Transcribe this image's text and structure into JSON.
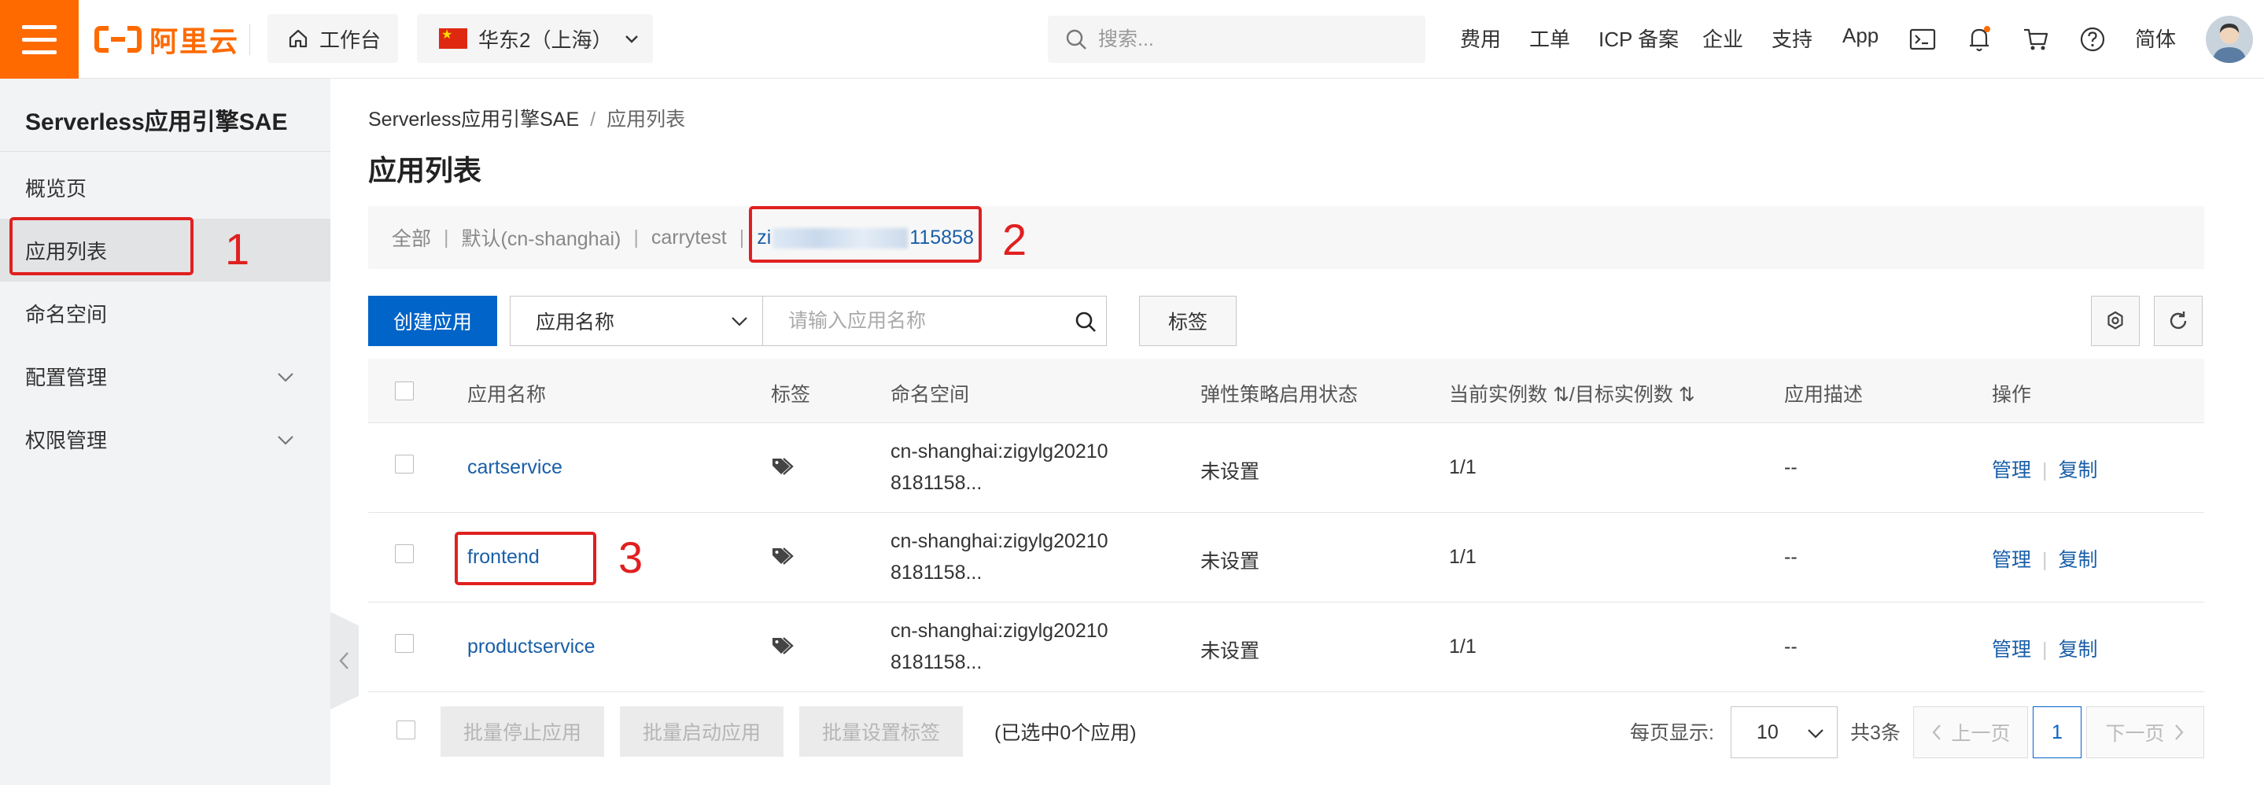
{
  "topbar": {
    "logo_text": "阿里云",
    "workbench_label": "工作台",
    "region_label": "华东2（上海）",
    "search_placeholder": "搜索...",
    "links": {
      "billing": "费用",
      "ticket": "工单",
      "icp": "ICP 备案",
      "enterprise": "企业",
      "support": "支持",
      "app": "App",
      "language": "简体"
    },
    "brand_color": "#ff6a00"
  },
  "sidebar": {
    "title": "Serverless应用引擎SAE",
    "items": [
      {
        "label": "概览页"
      },
      {
        "label": "应用列表"
      },
      {
        "label": "命名空间"
      },
      {
        "label": "配置管理"
      },
      {
        "label": "权限管理"
      }
    ]
  },
  "breadcrumb": {
    "root": "Serverless应用引擎SAE",
    "separator": "/",
    "current": "应用列表"
  },
  "page_title": "应用列表",
  "namespaces": {
    "all": "全部",
    "default": "默认(cn-shanghai)",
    "carrytest": "carrytest",
    "selected_prefix": "zi",
    "selected_suffix": "115858",
    "separator": "|"
  },
  "toolbar": {
    "create_label": "创建应用",
    "filter_select": "应用名称",
    "search_placeholder": "请输入应用名称",
    "tag_label": "标签"
  },
  "table": {
    "headers": {
      "name": "应用名称",
      "tag": "标签",
      "namespace": "命名空间",
      "scaling": "弹性策略启用状态",
      "instances": "当前实例数 ⇅/目标实例数 ⇅",
      "description": "应用描述",
      "actions": "操作"
    },
    "rows": [
      {
        "name": "cartservice",
        "ns_line1": "cn-shanghai:zigylg20210",
        "ns_line2": "8181158...",
        "scaling": "未设置",
        "instances": "1/1",
        "description": "--",
        "manage": "管理",
        "copy": "复制"
      },
      {
        "name": "frontend",
        "ns_line1": "cn-shanghai:zigylg20210",
        "ns_line2": "8181158...",
        "scaling": "未设置",
        "instances": "1/1",
        "description": "--",
        "manage": "管理",
        "copy": "复制"
      },
      {
        "name": "productservice",
        "ns_line1": "cn-shanghai:zigylg20210",
        "ns_line2": "8181158...",
        "scaling": "未设置",
        "instances": "1/1",
        "description": "--",
        "manage": "管理",
        "copy": "复制"
      }
    ]
  },
  "footer": {
    "batch_stop": "批量停止应用",
    "batch_start": "批量启动应用",
    "batch_tag": "批量设置标签",
    "selected_count": "(已选中0个应用)",
    "page_size_label": "每页显示:",
    "page_size": "10",
    "total": "共3条",
    "prev": "上一页",
    "current_page": "1",
    "next": "下一页"
  },
  "annotations": {
    "one": "1",
    "two": "2",
    "three": "3",
    "color": "#e02020"
  }
}
